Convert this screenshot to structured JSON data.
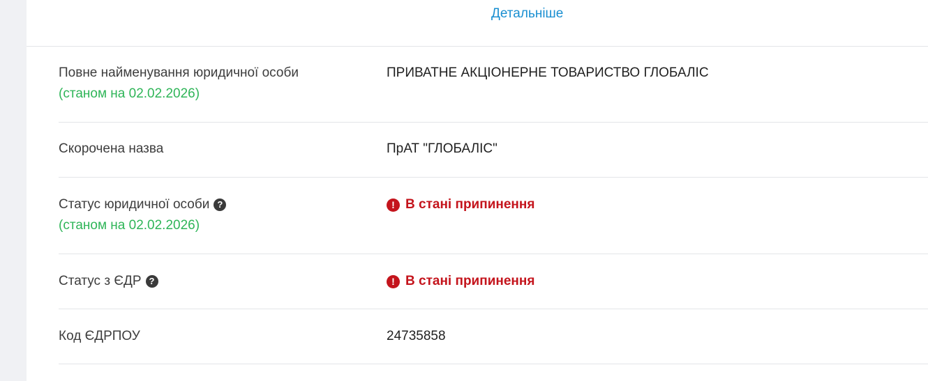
{
  "header": {
    "details_link": "Детальніше"
  },
  "rows": [
    {
      "label": "Повне найменування юридичної особи",
      "date_note": "(станом на 02.02.2026)",
      "value": "ПРИВАТНЕ АКЦІОНЕРНЕ ТОВАРИСТВО ГЛОБАЛІС"
    },
    {
      "label": "Скорочена назва",
      "value": "ПрАТ \"ГЛОБАЛІС\""
    },
    {
      "label": "Статус юридичної особи",
      "date_note": "(станом на 02.02.2026)",
      "value": "В стані припинення"
    },
    {
      "label": "Статус з ЄДР",
      "value": "В стані припинення"
    },
    {
      "label": "Код ЄДРПОУ",
      "value": "24735858"
    }
  ],
  "icons": {
    "help": "question-circle-icon",
    "alert": "exclamation-circle-icon"
  },
  "colors": {
    "link": "#1a8fd1",
    "date_note": "#2fb558",
    "status_alert": "#c4141c",
    "divider": "#e3e5e8",
    "page_background": "#f0f1f4"
  }
}
